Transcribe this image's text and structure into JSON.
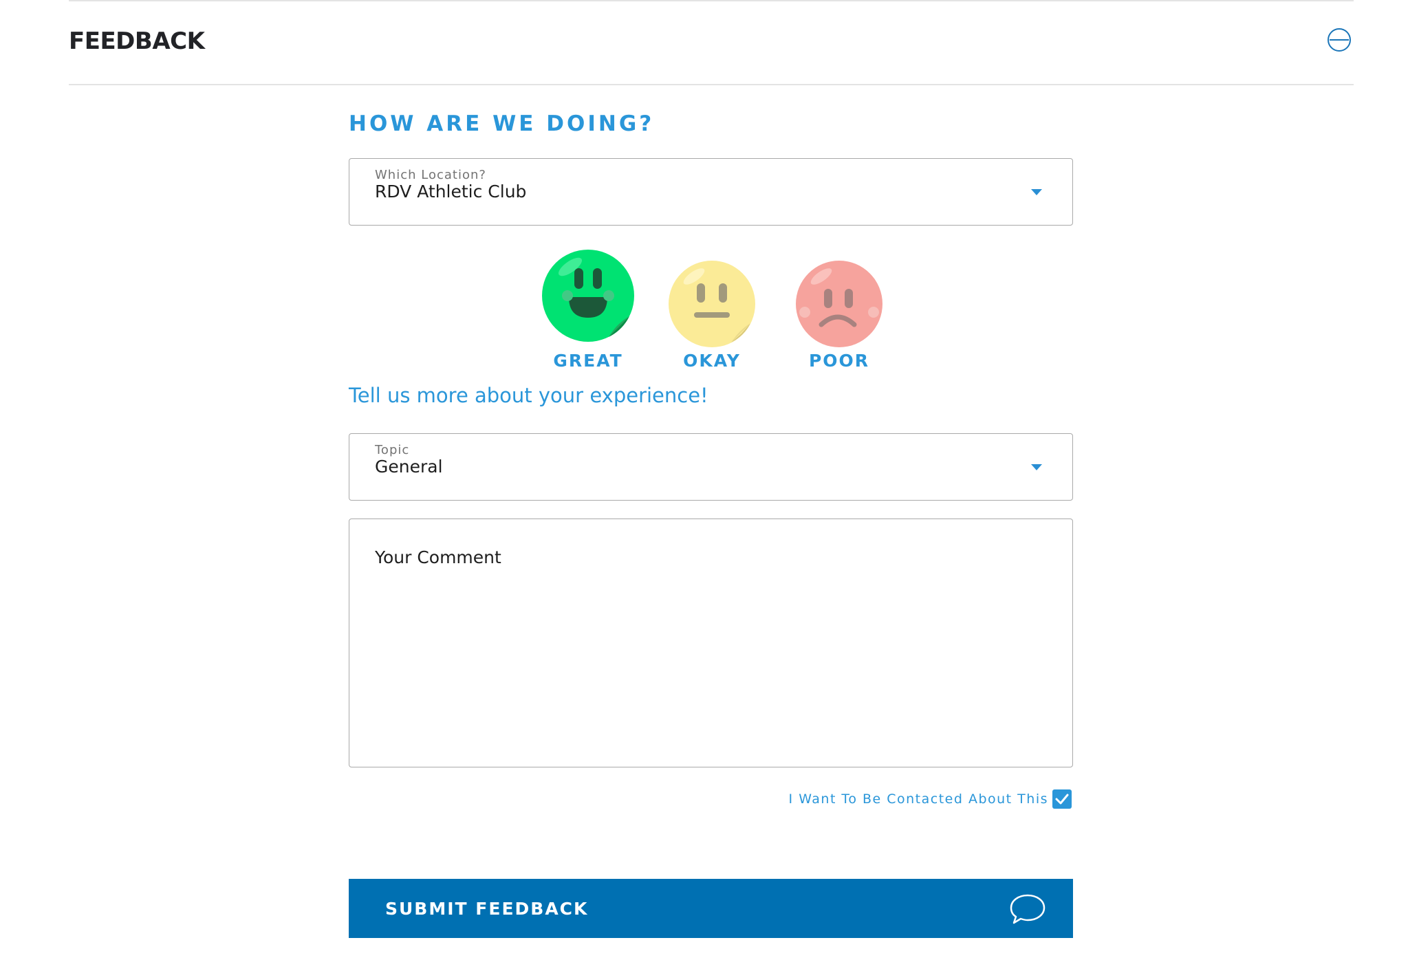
{
  "section": {
    "title": "FEEDBACK",
    "collapse_icon": "minus-circle-icon"
  },
  "form": {
    "heading": "HOW ARE WE DOING?",
    "location": {
      "label": "Which Location?",
      "value": "RDV Athletic Club"
    },
    "ratings": [
      {
        "label": "GREAT",
        "color": "#00e272",
        "icon": "happy-face-icon",
        "selected": true
      },
      {
        "label": "OKAY",
        "color": "#fbeb97",
        "icon": "neutral-face-icon",
        "selected": false
      },
      {
        "label": "POOR",
        "color": "#f6a39d",
        "icon": "sad-face-icon",
        "selected": false
      }
    ],
    "prompt": "Tell us more about your experience!",
    "topic": {
      "label": "Topic",
      "value": "General"
    },
    "comment": {
      "placeholder": "Your Comment"
    },
    "contact": {
      "label": "I Want To Be Contacted About This",
      "checked": true
    },
    "submit": {
      "label": "SUBMIT FEEDBACK",
      "icon": "chat-bubble-icon"
    }
  },
  "colors": {
    "accent": "#2a96d9",
    "button": "#0070b2",
    "title": "#222327"
  }
}
